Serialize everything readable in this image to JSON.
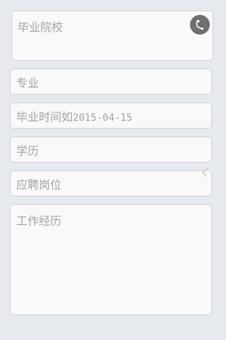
{
  "form": {
    "school_placeholder": "毕业院校",
    "major_placeholder": "专业",
    "graduation_prefix": "毕业时间如",
    "graduation_example": "2015-04-15",
    "education_placeholder": "学历",
    "position_placeholder": "应聘岗位",
    "experience_placeholder": "工作经历"
  },
  "icons": {
    "voice": "microphone-icon",
    "dropdown": "chevron-icon"
  },
  "colors": {
    "background": "#e6e9ed",
    "field_bg": "#f9f9f9",
    "placeholder": "#a3a3a3",
    "voice_button": "#6f6f6f"
  }
}
